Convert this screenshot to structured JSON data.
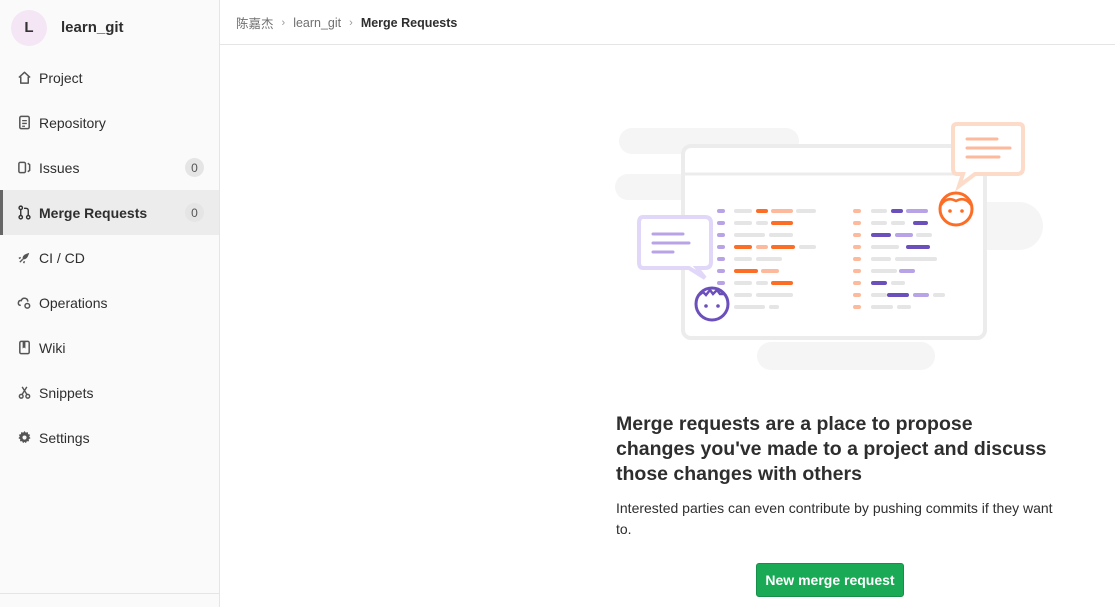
{
  "project": {
    "avatar_letter": "L",
    "name": "learn_git"
  },
  "nav": [
    {
      "id": "project",
      "label": "Project",
      "icon": "home-icon"
    },
    {
      "id": "repository",
      "label": "Repository",
      "icon": "document-icon"
    },
    {
      "id": "issues",
      "label": "Issues",
      "icon": "issues-icon",
      "count": "0"
    },
    {
      "id": "merge-requests",
      "label": "Merge Requests",
      "icon": "git-merge-icon",
      "count": "0",
      "active": true
    },
    {
      "id": "ci-cd",
      "label": "CI / CD",
      "icon": "rocket-icon"
    },
    {
      "id": "operations",
      "label": "Operations",
      "icon": "cloud-gear-icon"
    },
    {
      "id": "wiki",
      "label": "Wiki",
      "icon": "book-icon"
    },
    {
      "id": "snippets",
      "label": "Snippets",
      "icon": "scissors-icon"
    },
    {
      "id": "settings",
      "label": "Settings",
      "icon": "gear-icon"
    }
  ],
  "breadcrumb": {
    "user": "陈嘉杰",
    "project": "learn_git",
    "current": "Merge Requests"
  },
  "empty_state": {
    "title": "Merge requests are a place to propose changes you've made to a project and discuss those changes with others",
    "description": "Interested parties can even contribute by pushing commits if they want to.",
    "button": "New merge request"
  },
  "colors": {
    "accent_orange": "#fc6d26",
    "accent_purple": "#6b4fbb",
    "button_green": "#1aaa55"
  }
}
